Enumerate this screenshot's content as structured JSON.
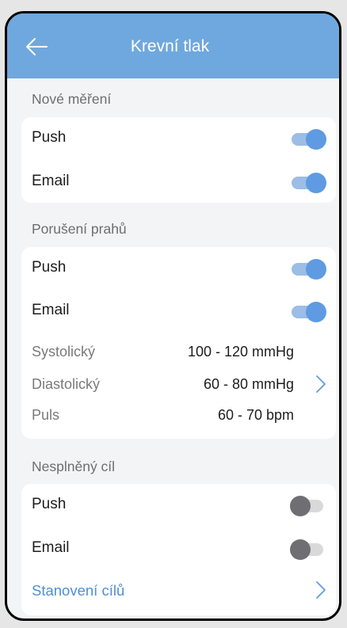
{
  "header": {
    "title": "Krevní tlak"
  },
  "sections": [
    {
      "label": "Nové měření",
      "rows": [
        {
          "label": "Push",
          "on": true
        },
        {
          "label": "Email",
          "on": true
        }
      ]
    },
    {
      "label": "Porušení prahů",
      "rows": [
        {
          "label": "Push",
          "on": true
        },
        {
          "label": "Email",
          "on": true
        }
      ],
      "thresholds": [
        {
          "label": "Systolický",
          "value": "100 - 120 mmHg"
        },
        {
          "label": "Diastolický",
          "value": "60 - 80 mmHg"
        },
        {
          "label": "Puls",
          "value": "60 - 70 bpm"
        }
      ]
    },
    {
      "label": "Nesplněný cíl",
      "rows": [
        {
          "label": "Push",
          "on": false
        },
        {
          "label": "Email",
          "on": false
        }
      ],
      "link": "Stanovení cílů"
    }
  ],
  "colors": {
    "appbar": "#6fa8de",
    "toggle_on": "#5e9be2",
    "toggle_off": "#6e6e73",
    "link": "#4d8fd9"
  },
  "icons": {
    "back": "arrow-left-icon",
    "chevron": "chevron-right-icon"
  }
}
